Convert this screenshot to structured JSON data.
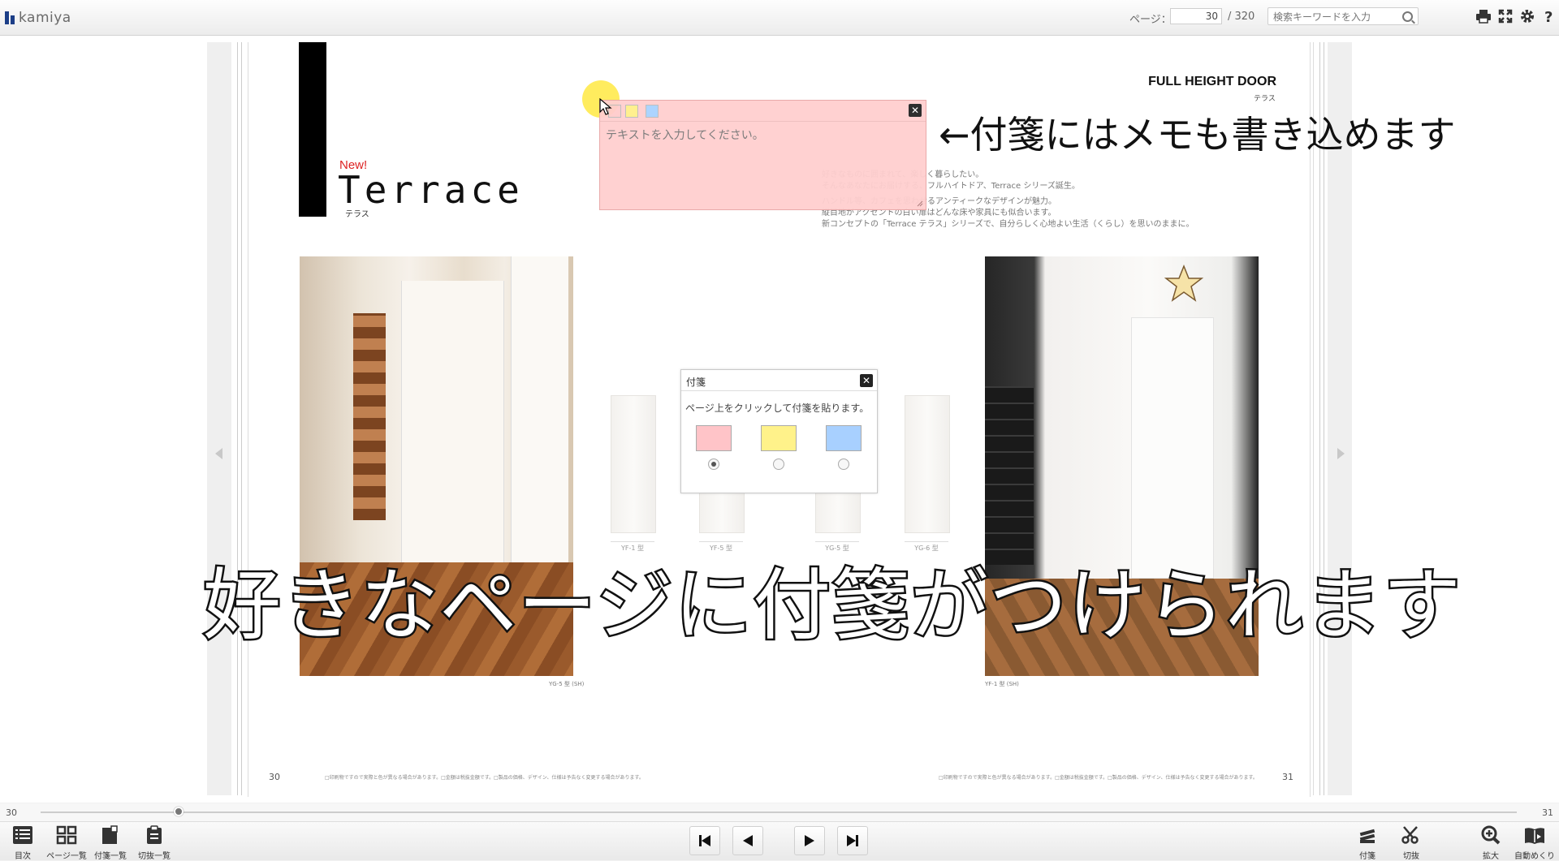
{
  "app": {
    "logo_text": "kamiya"
  },
  "toolbar": {
    "page_label": "ページ：",
    "page_value": "30",
    "page_total": "/ 320",
    "search_placeholder": "検索キーワードを入力",
    "icons": [
      "print-icon",
      "fullscreen-icon",
      "settings-icon",
      "help-icon"
    ]
  },
  "book": {
    "new_label": "New!",
    "series_title": "Terrace",
    "series_sub": "テラス",
    "brand": "FULL HEIGHT DOOR",
    "brand_sub": "テラス",
    "description": [
      "好きなものに囲まれて、楽しく暮らしたい。",
      "そんなあなたにお届けする、フルハイトドア、Terrace シリーズ誕生。",
      "ハンドル等、カフェを思わせるアンティークなデザインが魅力。",
      "縦目地がアクセントの白い扉はどんな床や家具にも似合います。",
      "新コンセプトの「Terrace テラス」シリーズで、自分らしく心地よい生活（くらし）を思いのままに。"
    ],
    "photo_left_caption": "YG-5 型 (SH)",
    "photo_right_caption": "YF-1 型 (SH)",
    "samples": [
      "YF-1 型",
      "YF-5 型",
      "YG-5 型",
      "YG-6 型"
    ],
    "left_page_number": "30",
    "right_page_number": "31",
    "footnote_left": "□印刷物ですので実際と色が異なる場合があります。□金額は税抜金額です。□製品の価格、デザイン、仕様は予告なく変更する場合があります。",
    "footnote_right": "□印刷物ですので実際と色が異なる場合があります。□金額は税抜金額です。□製品の価格、デザイン、仕様は予告なく変更する場合があります。"
  },
  "sticky_note": {
    "placeholder": "テキストを入力してください。",
    "colors": [
      "#ffcccc",
      "#fff08a",
      "#a8d2ff"
    ]
  },
  "annotation": "←付箋にはメモも書き込めます",
  "caption": "好きなページに付箋がつけられます",
  "dialog": {
    "title": "付箋",
    "message": "ページ上をクリックして付箋を貼ります。",
    "colors": [
      "#ffc4c8",
      "#fff28a",
      "#a8d0ff"
    ],
    "selected_index": 0
  },
  "slider": {
    "start": "30",
    "end": "31",
    "value": 30
  },
  "bottom_tools_left": [
    {
      "label": "目次",
      "icon": "list-icon"
    },
    {
      "label": "ページ一覧",
      "icon": "grid-icon"
    },
    {
      "label": "付箋一覧",
      "icon": "sticky-list-icon"
    },
    {
      "label": "切抜一覧",
      "icon": "clipboard-icon"
    }
  ],
  "bottom_tools_right": [
    {
      "label": "付箋",
      "icon": "sticky-icon"
    },
    {
      "label": "切抜",
      "icon": "scissors-icon"
    },
    {
      "label": "拡大",
      "icon": "zoom-in-icon"
    },
    {
      "label": "自動めくり",
      "icon": "auto-flip-icon"
    }
  ]
}
